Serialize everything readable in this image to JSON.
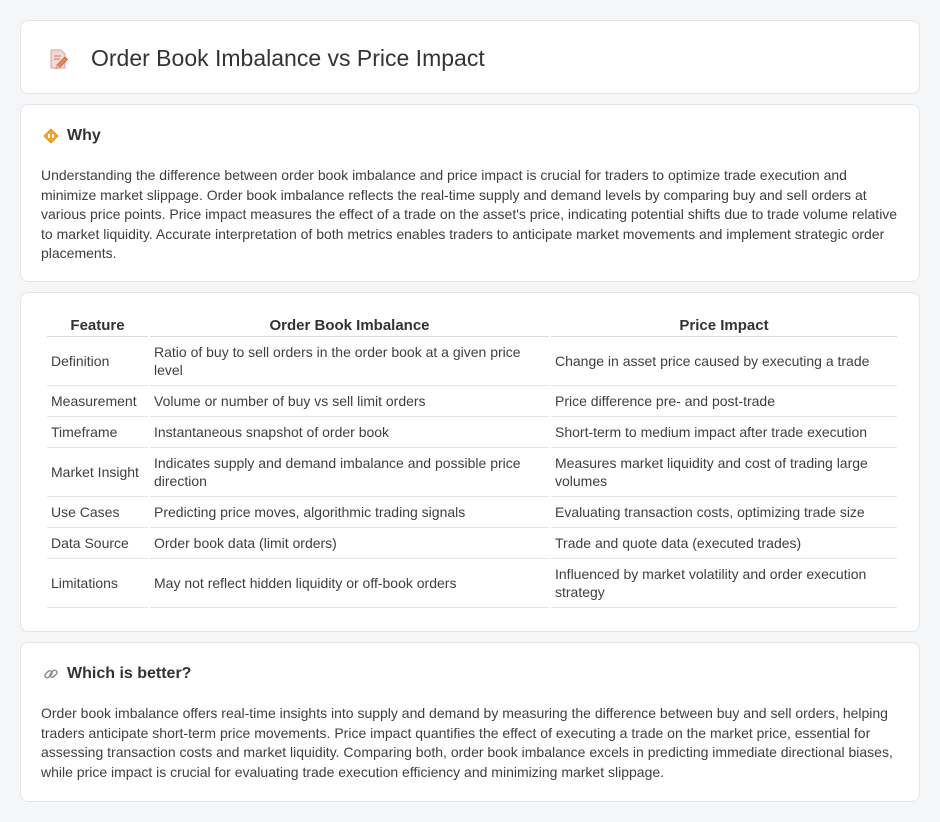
{
  "header": {
    "title": "Order Book Imbalance vs Price Impact",
    "icon": "pencil-document-icon"
  },
  "why": {
    "title": "Why",
    "icon": "diamond-warning-icon",
    "text": "Understanding the difference between order book imbalance and price impact is crucial for traders to optimize trade execution and minimize market slippage. Order book imbalance reflects the real-time supply and demand levels by comparing buy and sell orders at various price points. Price impact measures the effect of a trade on the asset's price, indicating potential shifts due to trade volume relative to market liquidity. Accurate interpretation of both metrics enables traders to anticipate market movements and implement strategic order placements."
  },
  "table": {
    "headers": [
      "Feature",
      "Order Book Imbalance",
      "Price Impact"
    ],
    "rows": [
      [
        "Definition",
        "Ratio of buy to sell orders in the order book at a given price level",
        "Change in asset price caused by executing a trade"
      ],
      [
        "Measurement",
        "Volume or number of buy vs sell limit orders",
        "Price difference pre- and post-trade"
      ],
      [
        "Timeframe",
        "Instantaneous snapshot of order book",
        "Short-term to medium impact after trade execution"
      ],
      [
        "Market Insight",
        "Indicates supply and demand imbalance and possible price direction",
        "Measures market liquidity and cost of trading large volumes"
      ],
      [
        "Use Cases",
        "Predicting price moves, algorithmic trading signals",
        "Evaluating transaction costs, optimizing trade size"
      ],
      [
        "Data Source",
        "Order book data (limit orders)",
        "Trade and quote data (executed trades)"
      ],
      [
        "Limitations",
        "May not reflect hidden liquidity or off-book orders",
        "Influenced by market volatility and order execution strategy"
      ]
    ]
  },
  "better": {
    "title": "Which is better?",
    "icon": "link-icon",
    "text": "Order book imbalance offers real-time insights into supply and demand by measuring the difference between buy and sell orders, helping traders anticipate short-term price movements. Price impact quantifies the effect of executing a trade on the market price, essential for assessing transaction costs and market liquidity. Comparing both, order book imbalance excels in predicting immediate directional biases, while price impact is crucial for evaluating trade execution efficiency and minimizing market slippage."
  }
}
